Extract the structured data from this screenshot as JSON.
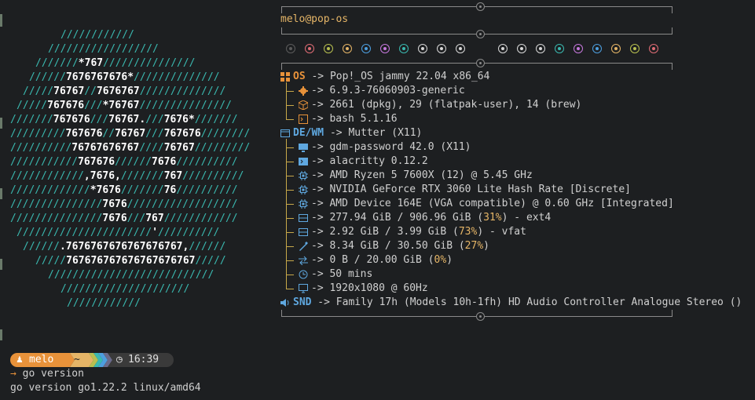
{
  "logo": {
    "lines": [
      [
        [
          "",
          "////////////"
        ]
      ],
      [
        [
          "",
          "//////////////////"
        ]
      ],
      [
        [
          "",
          "///////"
        ],
        [
          "b",
          "*767"
        ],
        [
          "",
          "///////////////"
        ]
      ],
      [
        [
          "",
          "//////"
        ],
        [
          "b",
          "7676767676*"
        ],
        [
          "",
          "//////////////"
        ]
      ],
      [
        [
          "",
          "/////"
        ],
        [
          "b",
          "76767"
        ],
        [
          "",
          "//"
        ],
        [
          "b",
          "7676767"
        ],
        [
          "",
          "//////////////"
        ]
      ],
      [
        [
          "",
          "/////"
        ],
        [
          "b",
          "767676"
        ],
        [
          "",
          "///"
        ],
        [
          "b",
          "*76767"
        ],
        [
          "",
          "///////////////"
        ]
      ],
      [
        [
          "",
          "///////"
        ],
        [
          "b",
          "767676"
        ],
        [
          "",
          "///"
        ],
        [
          "b",
          "76767."
        ],
        [
          "",
          "///"
        ],
        [
          "b",
          "7676*"
        ],
        [
          "",
          "///////"
        ]
      ],
      [
        [
          "",
          "/////////"
        ],
        [
          "b",
          "767676"
        ],
        [
          "",
          "//"
        ],
        [
          "b",
          "76767"
        ],
        [
          "",
          "///"
        ],
        [
          "b",
          "767676"
        ],
        [
          "",
          "////////"
        ]
      ],
      [
        [
          "",
          "//////////"
        ],
        [
          "b",
          "76767676767"
        ],
        [
          "",
          "////"
        ],
        [
          "b",
          "76767"
        ],
        [
          "",
          "/////////"
        ]
      ],
      [
        [
          "",
          "///////////"
        ],
        [
          "b",
          "767676"
        ],
        [
          "",
          "//////"
        ],
        [
          "b",
          "7676"
        ],
        [
          "",
          "//////////"
        ]
      ],
      [
        [
          "",
          "////////////"
        ],
        [
          "b",
          ",7676,"
        ],
        [
          "",
          "///////"
        ],
        [
          "b",
          "767"
        ],
        [
          "",
          "//////////"
        ]
      ],
      [
        [
          "",
          "/////////////"
        ],
        [
          "b",
          "*7676"
        ],
        [
          "",
          "///////"
        ],
        [
          "b",
          "76"
        ],
        [
          "",
          "//////////"
        ]
      ],
      [
        [
          "",
          "///////////////"
        ],
        [
          "b",
          "7676"
        ],
        [
          "",
          "//////////////////"
        ]
      ],
      [
        [
          "",
          "///////////////"
        ],
        [
          "b",
          "7676"
        ],
        [
          "",
          "///"
        ],
        [
          "b",
          "767"
        ],
        [
          "",
          "////////////"
        ]
      ],
      [
        [
          "",
          "//////////////////////"
        ],
        [
          "b",
          "'"
        ],
        [
          "",
          "//////////"
        ]
      ],
      [
        [
          "",
          "//////"
        ],
        [
          "b",
          ".7676767676767676767,"
        ],
        [
          "",
          "//////"
        ]
      ],
      [
        [
          "",
          "/////"
        ],
        [
          "b",
          "767676767676767676767"
        ],
        [
          "",
          "/////"
        ]
      ],
      [
        [
          "",
          "///////////////////////////"
        ]
      ],
      [
        [
          "",
          "/////////////////////"
        ]
      ],
      [
        [
          "",
          "////////////"
        ]
      ]
    ]
  },
  "info": {
    "user": "melo",
    "at": "@",
    "host": "pop-os",
    "palette": [
      "#5b5b5b",
      "#e06c75",
      "#b8c050",
      "#e5b567",
      "#4d9fe0",
      "#c678dd",
      "#3ab9b0",
      "#d8d8d8",
      "#d8d8d8",
      "#d8d8d8",
      "#d8d8d8",
      "#d8d8d8",
      "#d8d8d8",
      "#3ab9b0",
      "#c678dd",
      "#4d9fe0",
      "#e5b567",
      "#b8c050",
      "#e06c75"
    ],
    "accent_orange": "#e8923a",
    "accent_blue": "#5fa8e0",
    "os": {
      "key": "OS",
      "arrow": "->",
      "value": "Pop!_OS jammy 22.04 x86_64"
    },
    "os_items": [
      {
        "icon": "gear-icon",
        "value": "6.9.3-76060903-generic"
      },
      {
        "icon": "package-icon",
        "value": "2661 (dpkg), 29 (flatpak-user), 14 (brew)"
      },
      {
        "icon": "terminal-icon",
        "value": "bash 5.1.16"
      }
    ],
    "de": {
      "key": "DE/WM",
      "arrow": "->",
      "value": "Mutter (X11)"
    },
    "de_items": [
      {
        "icon": "monitor-icon",
        "value": "gdm-password 42.0 (X11)"
      },
      {
        "icon": "terminal-app-icon",
        "value": "alacritty 0.12.2"
      },
      {
        "icon": "cpu-icon",
        "value": "AMD Ryzen 5 7600X (12) @ 5.45 GHz"
      },
      {
        "icon": "gpu-icon",
        "value": "NVIDIA GeForce RTX 3060 Lite Hash Rate [Discrete]"
      },
      {
        "icon": "gpu-icon",
        "value": "AMD Device 164E (VGA compatible) @ 0.60 GHz [Integrated]"
      },
      {
        "icon": "disk-icon",
        "value": "277.94 GiB / 906.96 GiB (",
        "pct": "31%",
        "rest": ") - ext4"
      },
      {
        "icon": "disk-icon",
        "value": "2.92 GiB / 3.99 GiB (",
        "pct": "73%",
        "rest": ") - vfat"
      },
      {
        "icon": "memory-icon",
        "value": "8.34 GiB / 30.50 GiB (",
        "pct": "27%",
        "rest": ")"
      },
      {
        "icon": "swap-icon",
        "value": "0 B / 20.00 GiB (",
        "pct": "0%",
        "rest": ")"
      },
      {
        "icon": "clock-icon",
        "value": "50 mins"
      },
      {
        "icon": "display-icon",
        "value": "1920x1080 @ 60Hz"
      }
    ],
    "snd": {
      "key": "SND",
      "arrow": "->",
      "value": "Family 17h (Models 10h-1fh) HD Audio Controller Analogue Stereo ()"
    }
  },
  "prompt": {
    "user": "melo",
    "dir": "~",
    "time": "16:39",
    "command": "go version",
    "output": "go version go1.22.2 linux/amd64",
    "colors": {
      "user_bg": "#e8923a",
      "dir_bg": "#e5b567",
      "time_bg": "#3a3a3a",
      "chev1": "#b8c050",
      "chev2": "#3ab9b0",
      "chev3": "#4d9fe0",
      "chev4": "#6a6a8a"
    }
  }
}
